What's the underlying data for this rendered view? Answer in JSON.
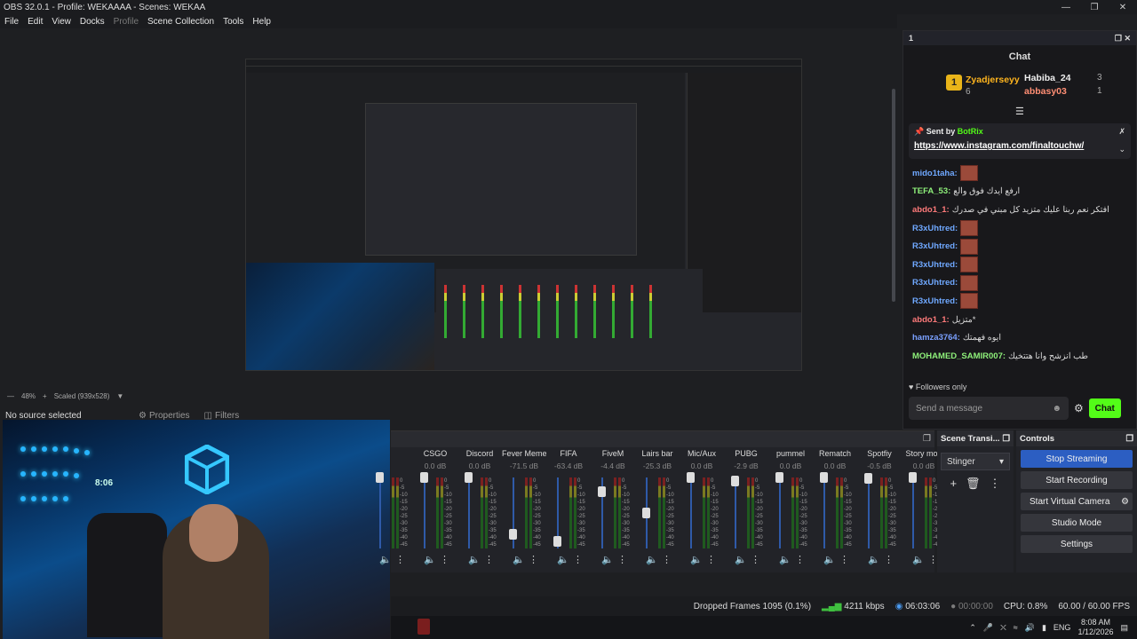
{
  "window": {
    "title": "OBS 32.0.1 - Profile: WEKAAAA - Scenes: WEKAA"
  },
  "menu": [
    "File",
    "Edit",
    "View",
    "Docks",
    "Profile",
    "Scene Collection",
    "Tools",
    "Help"
  ],
  "preview": {
    "zoom": "48%",
    "scaled": "Scaled (939x528)"
  },
  "sources": {
    "no_source": "No source selected",
    "properties": "Properties",
    "filters": "Filters"
  },
  "webcam": {
    "clock": "8:06"
  },
  "mixer": {
    "channels": [
      {
        "name": "",
        "db": ""
      },
      {
        "name": "CSGO",
        "db": "0.0 dB"
      },
      {
        "name": "Discord",
        "db": "0.0 dB"
      },
      {
        "name": "Fever Meme",
        "db": "-71.5 dB"
      },
      {
        "name": "FIFA",
        "db": "-63.4 dB"
      },
      {
        "name": "FiveM",
        "db": "-4.4 dB"
      },
      {
        "name": "Lairs bar",
        "db": "-25.3 dB"
      },
      {
        "name": "Mic/Aux",
        "db": "0.0 dB"
      },
      {
        "name": "PUBG",
        "db": "-2.9 dB"
      },
      {
        "name": "pummel",
        "db": "0.0 dB"
      },
      {
        "name": "Rematch",
        "db": "0.0 dB"
      },
      {
        "name": "Spotfiy",
        "db": "-0.5 dB"
      },
      {
        "name": "Story mod",
        "db": "0.0 dB"
      }
    ],
    "ticks": [
      "0",
      "-5",
      "-10",
      "-15",
      "-20",
      "-25",
      "-30",
      "-35",
      "-40",
      "-45",
      "-50",
      "-55",
      "-60"
    ]
  },
  "transitions": {
    "title": "Scene Transi...",
    "selected": "Stinger"
  },
  "controls": {
    "title": "Controls",
    "stop_streaming": "Stop Streaming",
    "start_recording": "Start Recording",
    "start_virtual_camera": "Start Virtual Camera",
    "studio_mode": "Studio Mode",
    "settings": "Settings"
  },
  "status": {
    "dropped": "Dropped Frames 1095 (0.1%)",
    "kbps": "4211 kbps",
    "stream_time": "06:03:06",
    "rec_time": "00:00:00",
    "cpu": "CPU: 0.8%",
    "fps": "60.00 / 60.00 FPS"
  },
  "taskbar": {
    "lang": "ENG",
    "time": "8:08 AM",
    "date": "1/12/2026"
  },
  "chat": {
    "dock_number": "1",
    "title": "Chat",
    "leaders": [
      {
        "rank": "1",
        "name": "Zyadjerseyy",
        "count": "6"
      },
      {
        "name": "Habiba_24",
        "count": "3"
      },
      {
        "name": "abbasy03",
        "count": "1"
      }
    ],
    "pinned": {
      "sent_by": "Sent by",
      "bot": "BotRix",
      "link": "https://www.instagram.com/finaltouchw/"
    },
    "messages": [
      {
        "user": "mido1taha:",
        "text": "",
        "color": "#6fa8ff",
        "emote": true
      },
      {
        "user": "TEFA_53:",
        "text": "ارفع ايدك فوق والع",
        "color": "#8ef07a",
        "emote": false
      },
      {
        "user": "abdo1_1:",
        "text": "افتكر نعم ربنا عليك متزيد كل مبني في صدرك",
        "color": "#ff7a7a",
        "emote": false
      },
      {
        "user": "R3xUhtred:",
        "text": "",
        "color": "#6fa8ff",
        "emote": true
      },
      {
        "user": "R3xUhtred:",
        "text": "",
        "color": "#6fa8ff",
        "emote": true
      },
      {
        "user": "R3xUhtred:",
        "text": "",
        "color": "#6fa8ff",
        "emote": true
      },
      {
        "user": "R3xUhtred:",
        "text": "",
        "color": "#6fa8ff",
        "emote": true
      },
      {
        "user": "R3xUhtred:",
        "text": "",
        "color": "#6fa8ff",
        "emote": true
      },
      {
        "user": "abdo1_1:",
        "text": "متزيل*",
        "color": "#ff7a7a",
        "emote": false
      },
      {
        "user": "hamza3764:",
        "text": "ايوه فهمتك",
        "color": "#7aa0ff",
        "emote": false
      },
      {
        "user": "MOHAMED_SAMIR007:",
        "text": "طب انزشح وانا هتتخيك",
        "color": "#8ef07a",
        "emote": false
      }
    ],
    "followers_only": "Followers only",
    "input_placeholder": "Send a message",
    "send": "Chat"
  },
  "colors": {
    "accent": "#2c5ec2",
    "kick_green": "#53fc18",
    "gold": "#e9b419"
  }
}
